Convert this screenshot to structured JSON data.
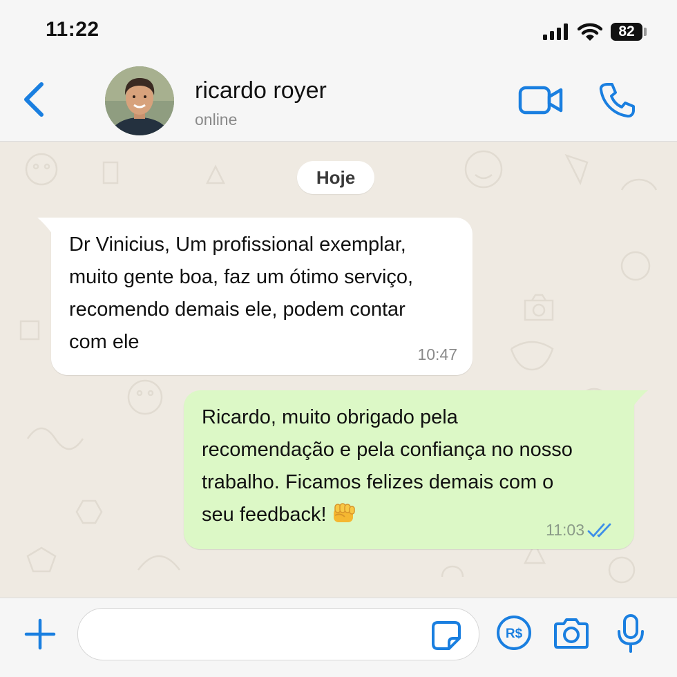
{
  "status_bar": {
    "time": "11:22",
    "battery": "82",
    "icons": [
      "signal-icon",
      "wifi-icon",
      "battery-icon"
    ]
  },
  "header": {
    "back_icon": "chevron-left-icon",
    "contact_name": "ricardo royer",
    "contact_status": "online",
    "video_icon": "video-camera-icon",
    "call_icon": "phone-icon",
    "accent_color": "#1a7fe0"
  },
  "chat": {
    "date_label": "Hoje",
    "messages": [
      {
        "direction": "incoming",
        "lines": [
          "Dr Vinicius, Um profissional exemplar,",
          "muito gente boa, faz um ótimo serviço,",
          "recomendo demais ele, podem contar",
          "com ele"
        ],
        "time": "10:47",
        "bubble_color": "#ffffff"
      },
      {
        "direction": "outgoing",
        "lines": [
          "Ricardo, muito obrigado pela",
          "recomendação e pela confiança no nosso",
          "trabalho. Ficamos felizes demais com o",
          "seu feedback!"
        ],
        "emoji": "oncoming-fist-emoji",
        "time": "11:03",
        "read_status": "double-check-read-icon",
        "bubble_color": "#dcf8c6"
      }
    ]
  },
  "input_bar": {
    "plus_icon": "plus-icon",
    "message_value": "",
    "sticker_icon": "sticker-icon",
    "pay_label": "R$",
    "camera_icon": "camera-icon",
    "mic_icon": "microphone-icon"
  }
}
